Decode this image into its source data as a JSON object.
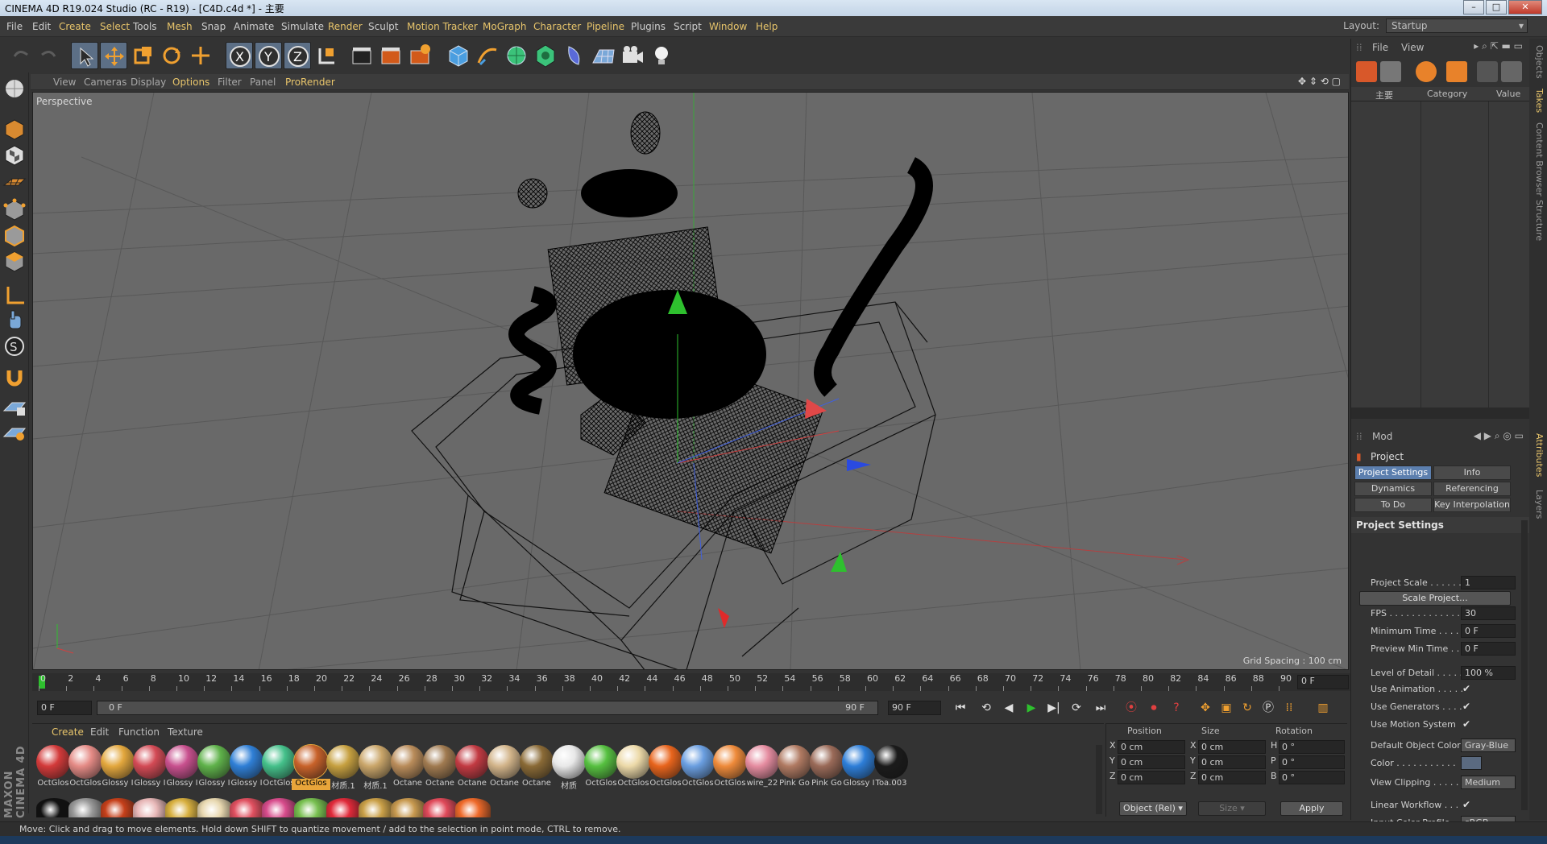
{
  "window": {
    "title": "CINEMA 4D R19.024 Studio (RC - R19) - [C4D.c4d *] - 主要"
  },
  "menubar": {
    "items": [
      "File",
      "Edit",
      "Create",
      "Select",
      "Tools",
      "Mesh",
      "Snap",
      "Animate",
      "Simulate",
      "Render",
      "Sculpt",
      "Motion Tracker",
      "MoGraph",
      "Character",
      "Pipeline",
      "Plugins",
      "Script",
      "Window",
      "Help"
    ],
    "layout_label": "Layout:",
    "layout_value": "Startup"
  },
  "viewport": {
    "menu": [
      "View",
      "Cameras",
      "Display",
      "Options",
      "Filter",
      "Panel",
      "ProRender"
    ],
    "label": "Perspective",
    "grid_spacing": "Grid Spacing : 100 cm"
  },
  "timeline": {
    "ticks": [
      "0",
      "2",
      "4",
      "6",
      "8",
      "10",
      "12",
      "14",
      "16",
      "18",
      "20",
      "22",
      "24",
      "26",
      "28",
      "30",
      "32",
      "34",
      "36",
      "38",
      "40",
      "42",
      "44",
      "46",
      "48",
      "50",
      "52",
      "54",
      "56",
      "58",
      "60",
      "62",
      "64",
      "66",
      "68",
      "70",
      "72",
      "74",
      "76",
      "78",
      "80",
      "82",
      "84",
      "86",
      "88",
      "90"
    ],
    "current_frame": "0 F"
  },
  "transport": {
    "start": "0 F",
    "slider_left": "0 F",
    "slider_right": "90 F",
    "end": "90 F"
  },
  "materials": {
    "menu": [
      "Create",
      "Edit",
      "Function",
      "Texture"
    ],
    "items": [
      {
        "label": "OctGlos",
        "color": "#d33a3a"
      },
      {
        "label": "OctGlos",
        "color": "#e58b86"
      },
      {
        "label": "Glossy I",
        "color": "#e3a73d"
      },
      {
        "label": "Glossy I",
        "color": "#d34a55"
      },
      {
        "label": "Glossy I",
        "color": "#c8508e"
      },
      {
        "label": "Glossy I",
        "color": "#5fb24a"
      },
      {
        "label": "Glossy I",
        "color": "#2f7fd6"
      },
      {
        "label": "OctGlos",
        "color": "#44c08a"
      },
      {
        "label": "OctGlos",
        "color": "#c8622a",
        "selected": true
      },
      {
        "label": "材质.1",
        "color": "#c6a040"
      },
      {
        "label": "材质.1",
        "color": "#caa66a"
      },
      {
        "label": "Octane",
        "color": "#b98c5a"
      },
      {
        "label": "Octane",
        "color": "#a07a50"
      },
      {
        "label": "Octane",
        "color": "#c23a42"
      },
      {
        "label": "Octane",
        "color": "#d2b48a"
      },
      {
        "label": "Octane",
        "color": "#8a6a36"
      },
      {
        "label": "材质",
        "color": "#e8e8e8"
      },
      {
        "label": "OctGlos",
        "color": "#56c040"
      },
      {
        "label": "OctGlos",
        "color": "#ecd9a8"
      },
      {
        "label": "OctGlos",
        "color": "#e8641c"
      },
      {
        "label": "OctGlos",
        "color": "#6a9ee0"
      },
      {
        "label": "OctGlos",
        "color": "#ee8a3a"
      },
      {
        "label": "wire_22",
        "color": "#e58ca0"
      },
      {
        "label": "Pink Go",
        "color": "#b07a62"
      },
      {
        "label": "Pink Go",
        "color": "#9a6a58"
      },
      {
        "label": "Glossy I",
        "color": "#2d7ed8"
      },
      {
        "label": "Toa.003",
        "color": "#1b1b1b"
      }
    ],
    "row2_colors": [
      "#111111",
      "#9a9a9a",
      "#c6401a",
      "#e8b8b8",
      "#d8b040",
      "#e8d8b0",
      "#e05060",
      "#d84c8c",
      "#78c050",
      "#e02a3a",
      "#caa048",
      "#c89a50",
      "#e04a5a",
      "#ef6a2a"
    ]
  },
  "coords": {
    "headers": [
      "Position",
      "Size",
      "Rotation"
    ],
    "rows": [
      {
        "axis": "X",
        "pos": "0 cm",
        "saxis": "X",
        "size": "0 cm",
        "raxis": "H",
        "rot": "0 °"
      },
      {
        "axis": "Y",
        "pos": "0 cm",
        "saxis": "Y",
        "size": "0 cm",
        "raxis": "P",
        "rot": "0 °"
      },
      {
        "axis": "Z",
        "pos": "0 cm",
        "saxis": "Z",
        "size": "0 cm",
        "raxis": "B",
        "rot": "0 °"
      }
    ],
    "mode": "Object (Rel)",
    "size_mode": "Size",
    "apply": "Apply"
  },
  "objects": {
    "menu": [
      "File",
      "View"
    ],
    "cols": [
      "主要",
      "Category",
      "Value"
    ]
  },
  "attributes": {
    "mode": "Mod",
    "title": "Project",
    "tabs": [
      "Project Settings",
      "Info",
      "Dynamics",
      "Referencing",
      "To Do",
      "Key Interpolation"
    ],
    "section": "Project Settings",
    "rows": [
      {
        "k": "Project Scale . . . . . .",
        "v": "1"
      },
      {
        "k": "FPS . . . . . . . . . . . . . .",
        "v": "30"
      },
      {
        "k": "Minimum Time . . . . .",
        "v": "0 F"
      },
      {
        "k": "Preview Min Time . . .",
        "v": "0 F"
      },
      {
        "k": "Level of Detail . . . . .",
        "v": "100 %"
      },
      {
        "k": "Use Animation . . . . .",
        "check": "✔"
      },
      {
        "k": "Use Generators . . . .",
        "check": "✔"
      },
      {
        "k": "Use Motion System",
        "check": "✔"
      },
      {
        "k": "Default Object Color",
        "v": "Gray-Blue"
      },
      {
        "k": "Color . . . . . . . . . . .",
        "v": ""
      },
      {
        "k": "View Clipping . . . . .",
        "v": "Medium"
      },
      {
        "k": "Linear Workflow . . .",
        "check": "✔"
      },
      {
        "k": "Input Color Profile . .",
        "v": "sRGB"
      }
    ],
    "scale_button": "Scale Project..."
  },
  "side_tabs": [
    "Objects",
    "Takes",
    "Content Browser",
    "Structure",
    "Attributes",
    "Layers"
  ],
  "status": "Move: Click and drag to move elements. Hold down SHIFT to quantize movement / add to the selection in point mode, CTRL to remove.",
  "brand": "MAXON CINEMA 4D"
}
